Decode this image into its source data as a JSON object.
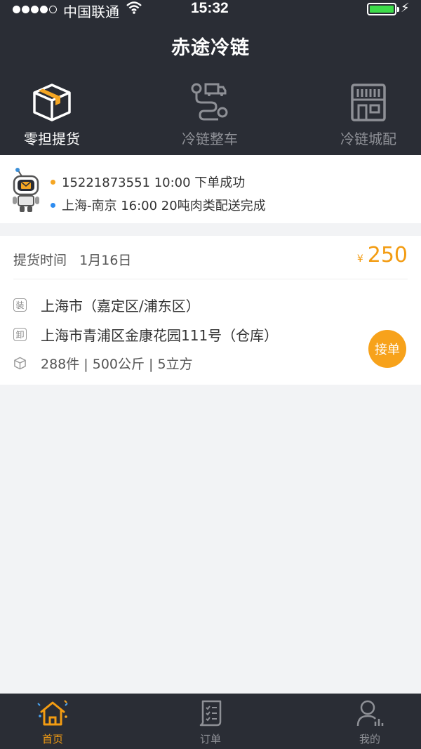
{
  "status_bar": {
    "carrier": "中国联通",
    "time": "15:32"
  },
  "header": {
    "title": "赤途冷链"
  },
  "categories": [
    {
      "label": "零担提货",
      "icon": "box-icon",
      "active": true
    },
    {
      "label": "冷链整车",
      "icon": "truck-route-icon",
      "active": false
    },
    {
      "label": "冷链城配",
      "icon": "store-icon",
      "active": false
    }
  ],
  "notices": [
    {
      "text": "15221873551  10:00 下单成功",
      "color": "#f5a623"
    },
    {
      "text": "上海-南京  16:00 20吨肉类配送完成",
      "color": "#2d8cf0"
    }
  ],
  "order": {
    "pickup_label": "提货时间",
    "pickup_date": "1月16日",
    "currency": "¥",
    "price": "250",
    "load_tag": "装",
    "load_address": "上海市（嘉定区/浦东区）",
    "unload_tag": "卸",
    "unload_address": "上海市青浦区金康花园111号（仓库）",
    "cargo": "288件 | 500公斤 | 5立方",
    "accept_label": "接单"
  },
  "tabs": [
    {
      "label": "首页",
      "active": true
    },
    {
      "label": "订单",
      "active": false
    },
    {
      "label": "我的",
      "active": false
    }
  ],
  "colors": {
    "accent": "#f39c12",
    "dark_bg": "#2a2d35",
    "page_bg": "#f2f3f5"
  }
}
